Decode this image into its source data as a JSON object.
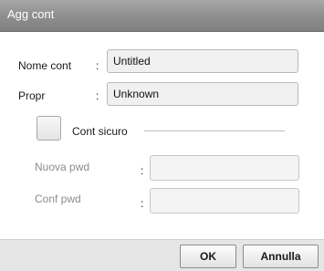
{
  "window": {
    "title": "Agg cont"
  },
  "form": {
    "name": {
      "label": "Nome cont",
      "separator": ":",
      "value": "Untitled"
    },
    "owner": {
      "label": "Propr",
      "separator": ":",
      "value": "Unknown"
    },
    "secure": {
      "label": "Cont sicuro",
      "checked": false
    },
    "new_password": {
      "label": "Nuova pwd",
      "separator": ":",
      "value": ""
    },
    "confirm_password": {
      "label": "Conf pwd",
      "separator": ":",
      "value": ""
    }
  },
  "footer": {
    "ok_label": "OK",
    "cancel_label": "Annulla"
  }
}
